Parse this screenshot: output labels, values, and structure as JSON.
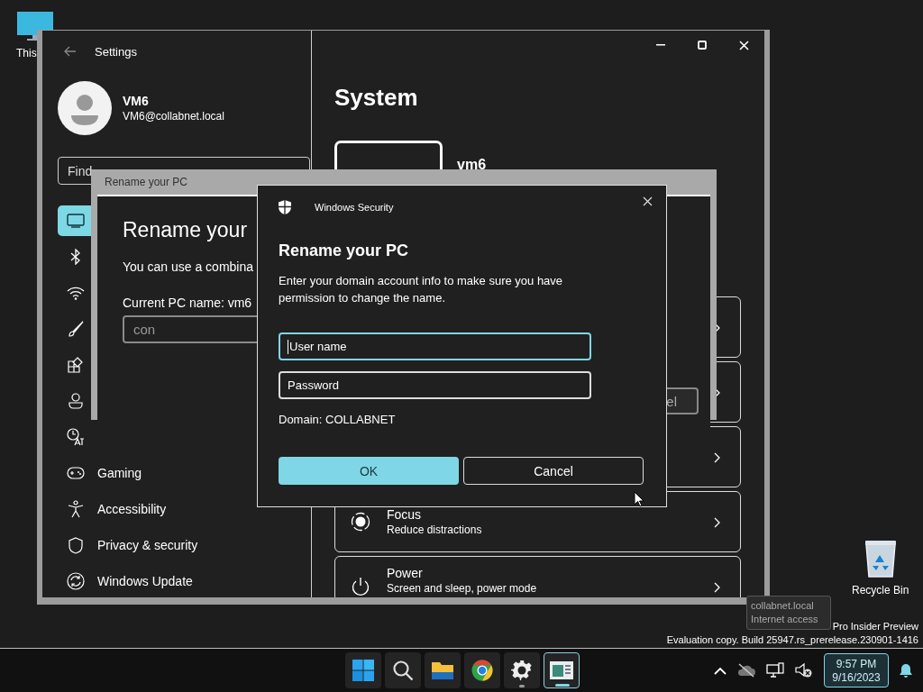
{
  "desktop_icons": [
    {
      "kind": "monitor",
      "label": "This"
    },
    {
      "kind": "recycle",
      "label": "Recycle Bin"
    }
  ],
  "settings": {
    "title": "Settings",
    "user": {
      "name": "VM6",
      "email": "VM6@collabnet.local"
    },
    "search": {
      "placeholder": "Find"
    },
    "nav": [
      {
        "kind": "system",
        "selected": true
      },
      {
        "kind": "bluetooth",
        "selected": false
      },
      {
        "kind": "wifi",
        "selected": false
      },
      {
        "kind": "brush",
        "selected": false
      },
      {
        "kind": "apps",
        "selected": false
      },
      {
        "kind": "accounts",
        "selected": false
      },
      {
        "kind": "time",
        "selected": false
      },
      {
        "kind": "gaming",
        "label": "Gaming",
        "selected": false
      },
      {
        "kind": "accessibility",
        "label": "Accessibility",
        "selected": false
      },
      {
        "kind": "privacy",
        "label": "Privacy & security",
        "selected": false
      },
      {
        "kind": "update",
        "label": "Windows Update",
        "selected": false
      }
    ],
    "heading": "System",
    "device_name": "vm6",
    "cards": [
      {
        "kind": "plain"
      },
      {
        "kind": "plain"
      },
      {
        "kind": "plain"
      },
      {
        "kind": "focus",
        "title": "Focus",
        "subtitle": "Reduce distractions"
      },
      {
        "kind": "power",
        "title": "Power",
        "subtitle": "Screen and sleep, power mode"
      }
    ]
  },
  "rename_dialog": {
    "title": "Rename your PC",
    "heading": "Rename your",
    "text": "You can use a combina",
    "current_name": "Current PC name: vm6",
    "input_value": "con",
    "button": "el"
  },
  "security_dialog": {
    "app": "Windows Security",
    "title": "Rename your PC",
    "message": "Enter your domain account info to make sure you have permission to change the name.",
    "fields": [
      {
        "placeholder": "User name",
        "focused": true
      },
      {
        "placeholder": "Password",
        "focused": false
      }
    ],
    "domain": "Domain: COLLABNET",
    "buttons": [
      {
        "label": "OK",
        "primary": true
      },
      {
        "label": "Cancel",
        "primary": false
      }
    ]
  },
  "tooltip": {
    "lines": [
      "collabnet.local",
      "Internet access"
    ]
  },
  "system_notice": [
    "Pro Insider Preview",
    "Evaluation copy. Build 25947.rs_prerelease.230901-1416"
  ],
  "taskbar": {
    "apps": [
      {
        "kind": "start",
        "running": false,
        "active": false
      },
      {
        "kind": "search",
        "running": false,
        "active": false
      },
      {
        "kind": "folder",
        "running": false,
        "active": false
      },
      {
        "kind": "browser",
        "running": false,
        "active": false
      },
      {
        "kind": "gear",
        "running": true,
        "active": false
      },
      {
        "kind": "window",
        "running": true,
        "active": true
      }
    ],
    "tray": [
      {
        "kind": "chevron"
      },
      {
        "kind": "cloud-off"
      },
      {
        "kind": "network"
      },
      {
        "kind": "volume-muted"
      }
    ],
    "clock": {
      "time": "9:57 PM",
      "date": "9/16/2023"
    }
  }
}
